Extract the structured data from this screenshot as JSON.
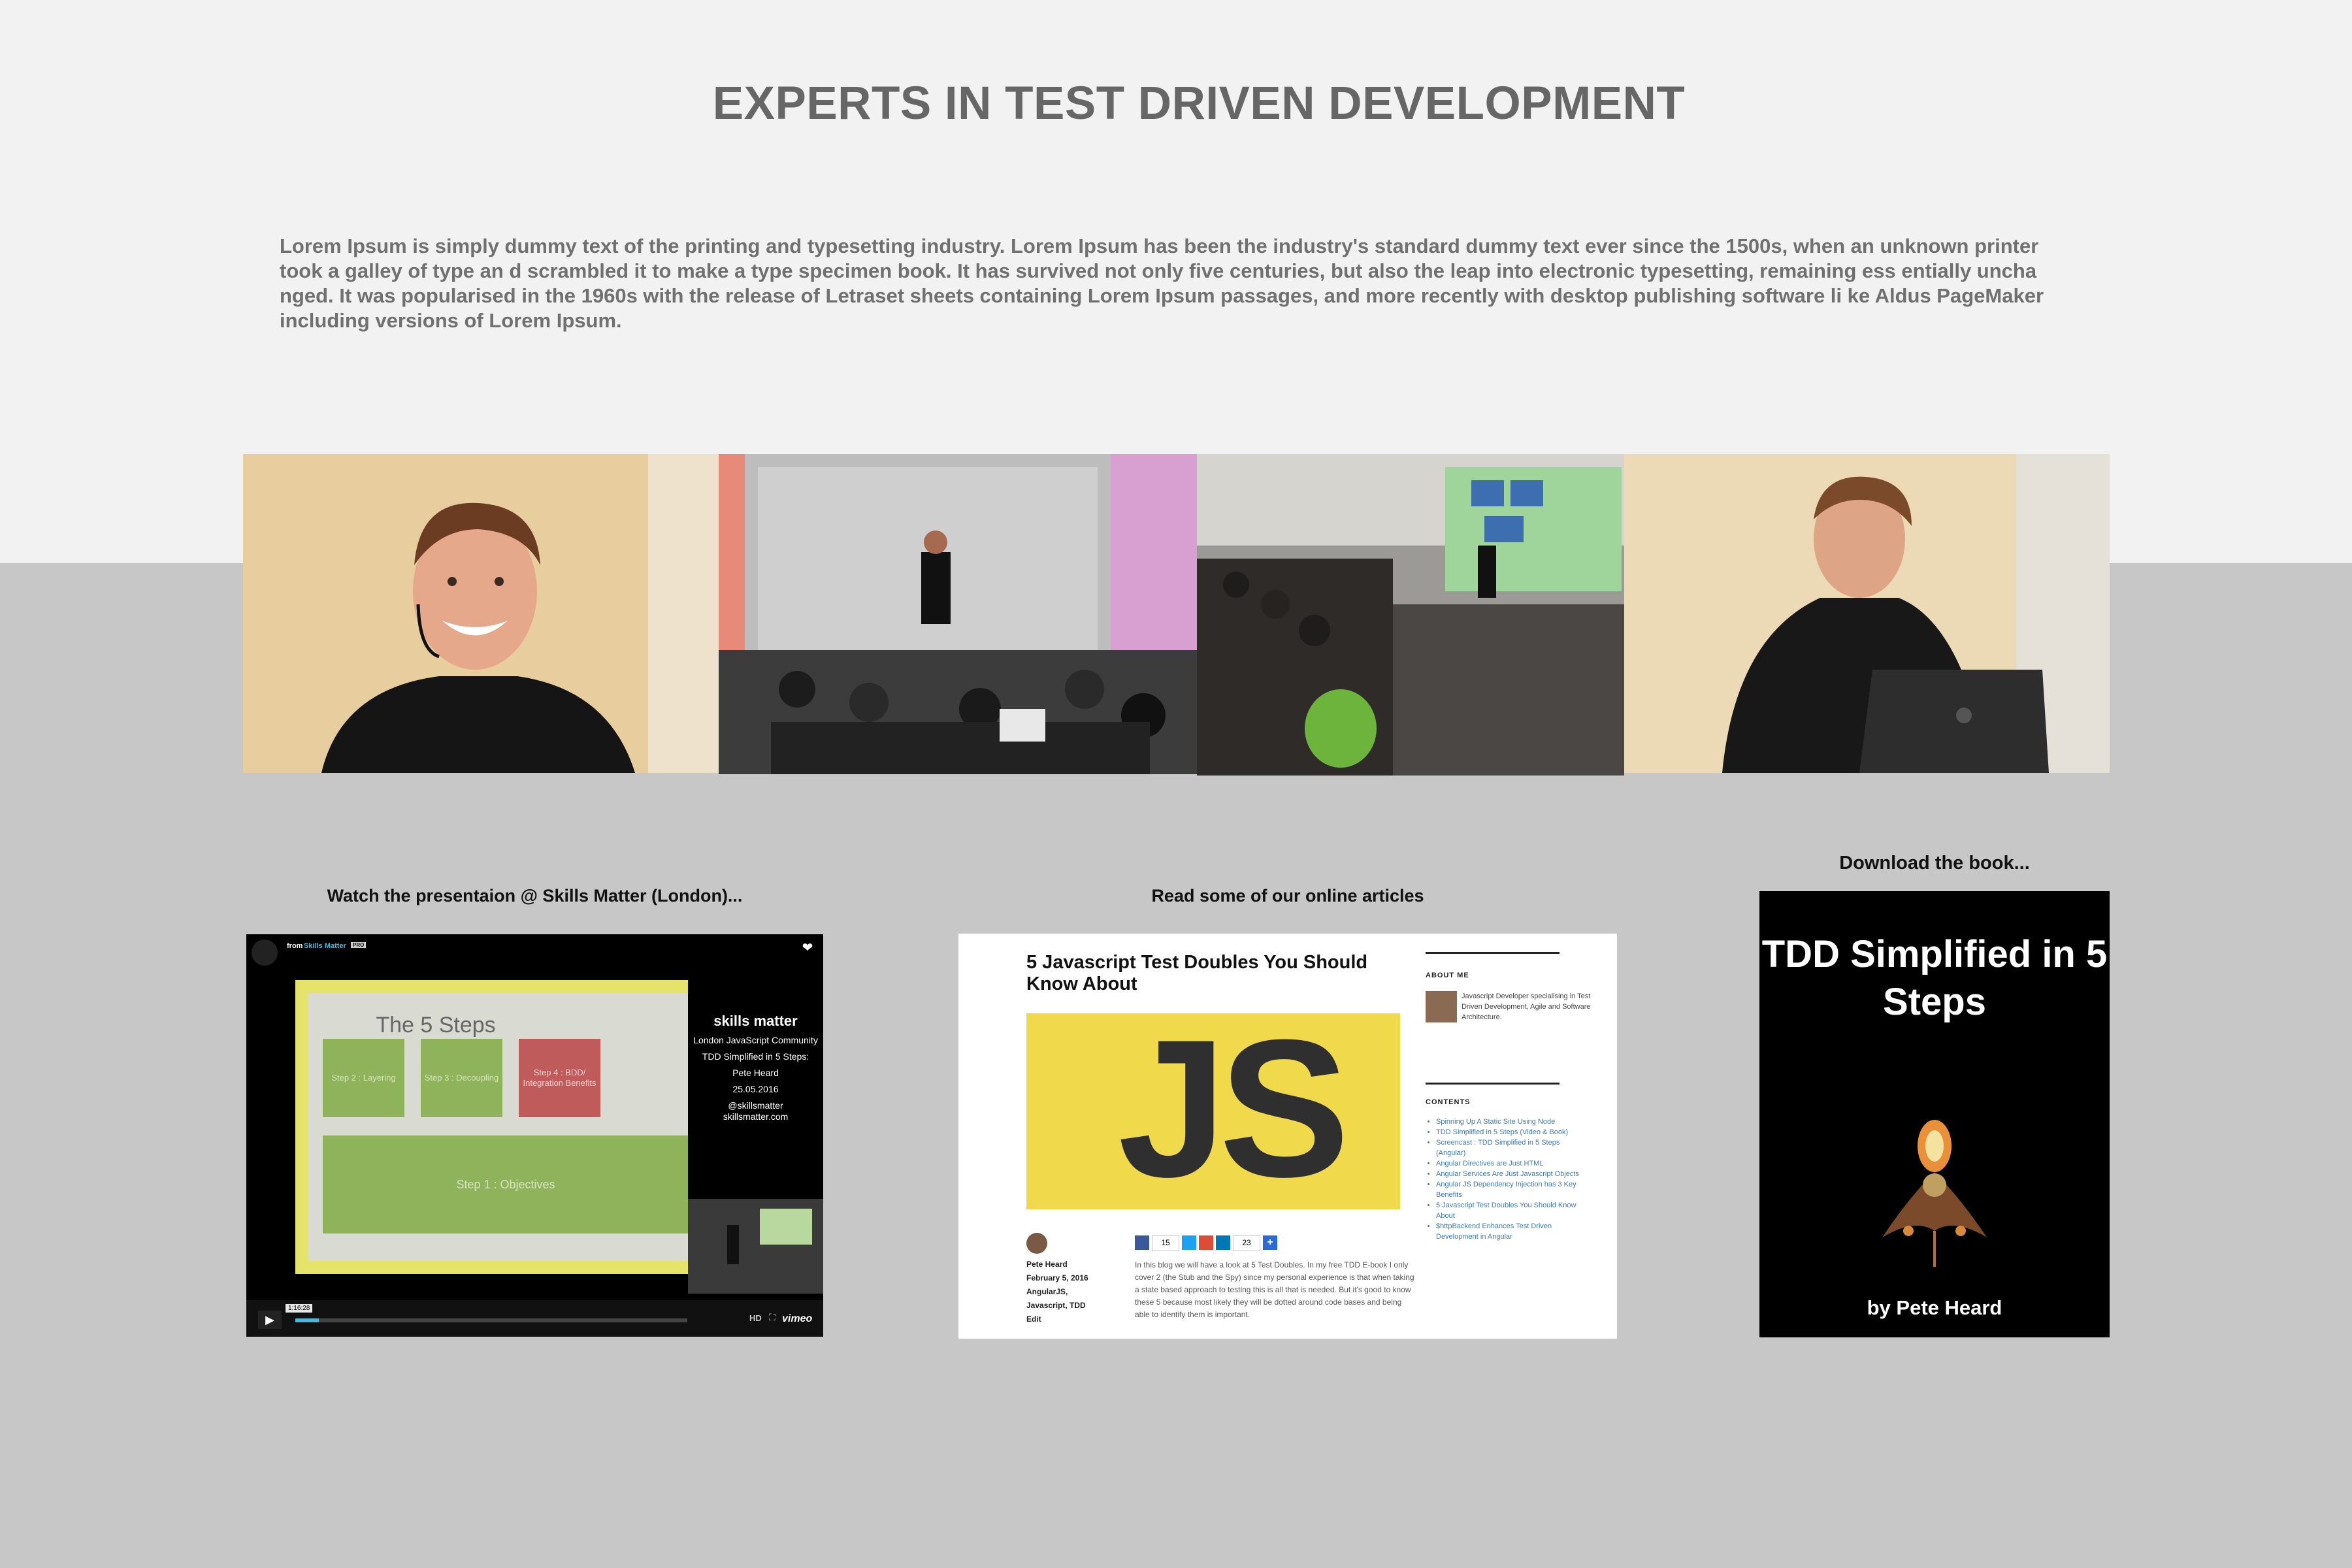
{
  "header": {
    "title": "EXPERTS IN TEST DRIVEN DEVELOPMENT",
    "intro": "Lorem Ipsum is simply dummy text of the printing and typesetting industry. Lorem Ipsum has been the industry's standard dummy text ever since the 1500s, when an unknown  printer took a galley of type an d scrambled it to make a type specimen book. It has survived not only five centuries, but also the leap into electronic typesetting, remaining ess entially unchanged. It was popularised in the 1960s with the release of Letraset sheets containing Lorem Ipsum passages, and more recently with desktop publishing software li ke Aldus PageMaker including versions of Lorem Ipsum."
  },
  "colors": {
    "top_band": "#f2f2f2",
    "bottom_band": "#c7c7c7",
    "title": "#666666",
    "slide_green": "#8fb35a",
    "slide_red": "#c05b5b",
    "js_yellow": "#f0d94a"
  },
  "video": {
    "caption": "Watch the presentaion @  Skills Matter (London)...",
    "topbar_from": "from",
    "topbar_channel": "Skills Matter",
    "topbar_badge": "PRO",
    "slide_title": "The 5 Steps",
    "steps": [
      {
        "label": "Step 2 : Layering"
      },
      {
        "label": "Step 3 : Decoupling"
      },
      {
        "label": "Step 4 : BDD/ Integration Benefits"
      }
    ],
    "step_big": "Step 1 : Objectives",
    "brand": "skills matter",
    "community": "London JavaScript Community",
    "talk": "TDD Simplified in 5 Steps:",
    "speaker": "Pete Heard",
    "date": "25.05.2016",
    "handle": "@skillsmatter",
    "site": "skillsmatter.com",
    "timecode": "1:16:28",
    "progress": 0.06,
    "hd_label": "HD",
    "player_logo": "vimeo",
    "icons": [
      "play-icon",
      "heart-icon",
      "fullscreen-icon"
    ]
  },
  "article": {
    "caption": "Read some of our online articles",
    "title": "5 Javascript Test Doubles You Should Know About",
    "hero_text": "JS",
    "about_heading": "ABOUT ME",
    "about_text": "Javascript Developer specialising in Test Driven Development, Agile and Software Architecture.",
    "contents_heading": "CONTENTS",
    "contents": [
      "Spinning Up A Static Site Using Node",
      "TDD Simplified in 5 Steps (Video & Book)",
      "Screencast : TDD Simplified in 5 Steps (Angular)",
      "Angular Directives are Just HTML",
      "Angular Services Are Just Javascript Objects",
      "Angular JS Dependency Injection has 3 Key Benefits",
      "5 Javascript Test Doubles You Should Know About",
      "$httpBackend Enhances Test Driven Development in Angular"
    ],
    "author": "Pete Heard",
    "date": "February 5, 2016",
    "tags": "AngularJS, Javascript, TDD",
    "edit": "Edit",
    "share_counts": [
      "15",
      "23"
    ],
    "excerpt": "In this blog we will have a look at 5 Test Doubles. In my free TDD E-book I only cover 2 (the Stub and the Spy) since my personal experience is that when taking a state based approach to testing this is all that is needed. But it's good to know these 5 because most likely they will be dotted around code bases and being able to identify them is important."
  },
  "book": {
    "caption": "Download the book...",
    "title": "TDD Simplified in 5 Steps",
    "author": "by Pete Heard"
  }
}
